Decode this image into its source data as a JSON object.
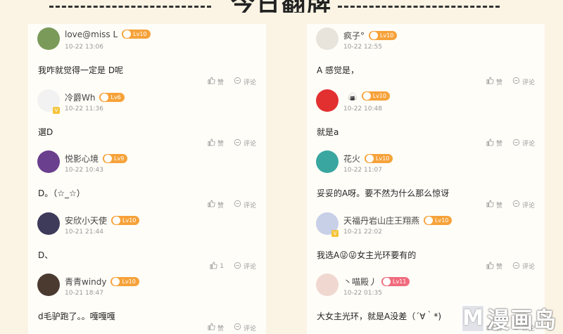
{
  "header": {
    "title": "今日翻牌"
  },
  "actions": {
    "like": "赞",
    "comment": "评论"
  },
  "left_comments": [
    {
      "name": "love@miss L",
      "level": "Lv10",
      "time": "10-22 13:06",
      "text": "我咋就觉得一定是 D呢",
      "likes": "赞",
      "vip": false,
      "avatar_color": "#7a9a5a"
    },
    {
      "name": "冷爵Wh",
      "level": "Lv6",
      "time": "10-22 11:36",
      "text": "選D",
      "likes": "赞",
      "vip": true,
      "avatar_color": "#f2f2f2"
    },
    {
      "name": "悦影心境",
      "level": "Lv9",
      "time": "10-22 10:43",
      "text": "D。（☆_☆）",
      "likes": "赞",
      "vip": false,
      "avatar_color": "#6a3f8e"
    },
    {
      "name": "安欣小天使",
      "level": "Lv10",
      "time": "10-21 21:44",
      "text": "D、",
      "likes": "1",
      "vip": false,
      "avatar_color": "#3d3a5a"
    },
    {
      "name": "青青windy",
      "level": "Lv10",
      "time": "10-21 18:47",
      "text": "d毛驴跑了。。嘎嘎嘎",
      "likes": "赞",
      "vip": false,
      "avatar_color": "#4a3a30"
    }
  ],
  "right_comments": [
    {
      "name": "疯子°",
      "level": "Lv10",
      "time": "10-22 12:55",
      "text": "A 感觉是，",
      "likes": "赞",
      "vip": false,
      "avatar_color": "#e8e4dc",
      "pre": ""
    },
    {
      "name": "",
      "level": "Lv10",
      "time": "10-22 10:48",
      "text": "就是a",
      "likes": "赞",
      "vip": false,
      "avatar_color": "#e23030",
      "pre": "🍙"
    },
    {
      "name": "花火",
      "level": "Lv10",
      "time": "10-22 11:07",
      "text": "妥妥的A呀。要不然为什么那么惊讶",
      "likes": "赞",
      "vip": false,
      "avatar_color": "#3aa6a0",
      "pre": ""
    },
    {
      "name": "天福丹岩山庄王翔燕",
      "level": "Lv10",
      "time": "10-21 22:02",
      "text": "我选A😜😜女主光环要有的",
      "likes": "赞",
      "vip": true,
      "avatar_color": "#c8d0e8",
      "pre": ""
    },
    {
      "name": "丶喵殿丿",
      "level": "Lv11",
      "time": "10-22 01:35",
      "text": "大女主光环，就是A没差（´∀｀*)",
      "likes": "赞",
      "vip": false,
      "avatar_color": "#f0d8d0",
      "pre": ""
    }
  ],
  "watermark": {
    "letter": "M",
    "text": "漫画岛"
  }
}
